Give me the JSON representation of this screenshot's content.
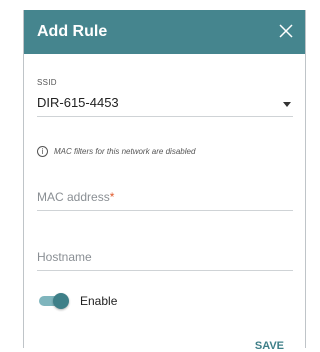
{
  "dialog": {
    "title": "Add Rule",
    "close_icon": "close-icon",
    "header_color": "#45858e"
  },
  "ssid": {
    "label": "SSID",
    "value": "DIR-615-4453"
  },
  "info": {
    "icon": "info-icon",
    "text": "MAC filters for this network are disabled"
  },
  "mac": {
    "placeholder": "MAC address",
    "required_mark": "*"
  },
  "hostname": {
    "placeholder": "Hostname"
  },
  "enable": {
    "label": "Enable",
    "checked": true
  },
  "actions": {
    "save_label": "SAVE"
  }
}
